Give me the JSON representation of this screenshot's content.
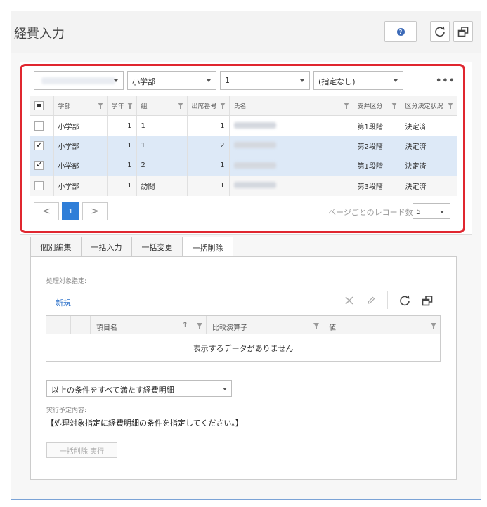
{
  "header": {
    "title": "経費入力",
    "help_icon": "?"
  },
  "filters": {
    "org_blurred": "",
    "school": "小学部",
    "grade": "1",
    "class": "(指定なし)",
    "more": "•••"
  },
  "grid": {
    "columns": [
      "学部",
      "学年",
      "組",
      "出席番号",
      "氏名",
      "支弁区分",
      "区分決定状況"
    ],
    "rows": [
      {
        "checked": false,
        "dept": "小学部",
        "grade": "1",
        "class": "1",
        "number": "1",
        "category": "第1段階",
        "status": "決定済"
      },
      {
        "checked": true,
        "dept": "小学部",
        "grade": "1",
        "class": "1",
        "number": "2",
        "category": "第2段階",
        "status": "決定済"
      },
      {
        "checked": true,
        "dept": "小学部",
        "grade": "1",
        "class": "2",
        "number": "1",
        "category": "第1段階",
        "status": "決定済"
      },
      {
        "checked": false,
        "dept": "小学部",
        "grade": "1",
        "class": "訪問",
        "number": "1",
        "category": "第3段階",
        "status": "決定済"
      }
    ]
  },
  "pagination": {
    "prev": "<",
    "page": "1",
    "next": ">",
    "per_page_label": "ページごとのレコード数",
    "per_page_value": "5"
  },
  "tabs": [
    "個別編集",
    "一括入力",
    "一括変更",
    "一括削除"
  ],
  "bulk_delete": {
    "target_label": "処理対象指定:",
    "new_link": "新規",
    "sub_columns": [
      "項目名",
      "比較演算子",
      "値"
    ],
    "empty_message": "表示するデータがありません",
    "condition_select": "以上の条件をすべて満たす経費明細",
    "exec_label": "実行予定内容:",
    "exec_text": "【処理対象指定に経費明細の条件を指定してください。】",
    "exec_button": "一括削除 実行"
  },
  "colors": {
    "accent": "#2f7ed8",
    "selected_row": "#dde9f7",
    "highlight": "#e0262f"
  }
}
